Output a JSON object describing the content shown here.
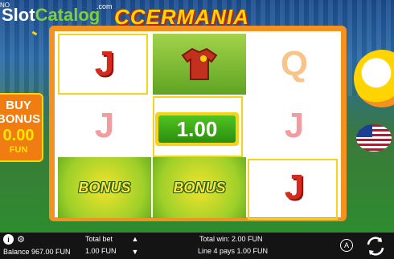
{
  "logo": {
    "slot": "Slot",
    "catalog": "Catalog",
    "com": ".com"
  },
  "game_title": "CCERMANIA",
  "corner_text": "NO",
  "buy_bonus": {
    "line1": "BUY",
    "line2": "BONUS",
    "price": "0.00",
    "currency": "FUN"
  },
  "reels": [
    [
      {
        "symbol": "J",
        "style": "red"
      },
      {
        "symbol": "J",
        "style": "pink"
      },
      {
        "symbol": "BONUS",
        "style": "bonus"
      }
    ],
    [
      {
        "symbol": "jersey-icon",
        "style": "green"
      },
      {
        "symbol": "",
        "style": "plain"
      },
      {
        "symbol": "BONUS",
        "style": "bonus"
      }
    ],
    [
      {
        "symbol": "Q",
        "style": "orange"
      },
      {
        "symbol": "J",
        "style": "pink"
      },
      {
        "symbol": "J",
        "style": "red"
      }
    ]
  ],
  "win_amount": "1.00",
  "bottom_bar": {
    "balance": "Balance 967.00 FUN",
    "total_bet_label": "Total bet",
    "total_bet_value": "1.00 FUN",
    "total_win": "Total win: 2.00 FUN",
    "line_win": "Line 4 pays 1.00 FUN",
    "auto_label": "A"
  },
  "colors": {
    "frame": "#f39220",
    "payline": "#f7d21b",
    "win": "#2a8e0f",
    "bar": "#141414"
  }
}
